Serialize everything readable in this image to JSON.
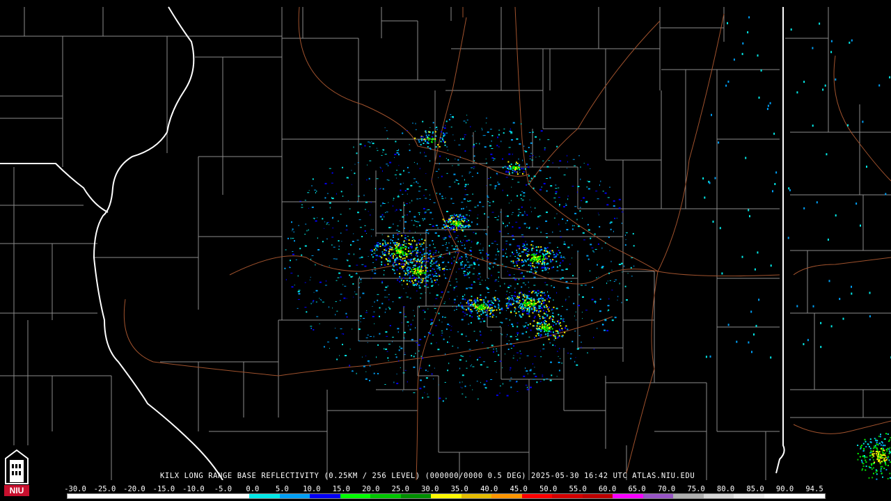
{
  "product": {
    "title": "KILX LONG RANGE BASE REFLECTIVITY (0.25KM / 256 LEVEL) (000000/0000 0.5 DEG) 2025-05-30 16:42 UTC  ATLAS.NIU.EDU"
  },
  "logo": {
    "text": "NIU",
    "icon": "niu-tower-logo-icon",
    "color": "#c8102e"
  },
  "colors": {
    "background": "#000000",
    "county_border": "#8c8c8c",
    "state_border": "#ffffff",
    "highway": "#a0522d"
  },
  "color_scale": {
    "labels": [
      "-30.0",
      "-25.0",
      "-20.0",
      "-15.0",
      "-10.0",
      "-5.0",
      "0.0",
      "5.0",
      "10.0",
      "15.0",
      "20.0",
      "25.0",
      "30.0",
      "35.0",
      "40.0",
      "45.0",
      "50.0",
      "55.0",
      "60.0",
      "65.0",
      "70.0",
      "75.0",
      "80.0",
      "85.0",
      "90.0",
      "94.5"
    ],
    "colors": [
      "#ffffff",
      "#ffffff",
      "#ffffff",
      "#ffffff",
      "#ffffff",
      "#ffffff",
      "#04e9e7",
      "#019ff4",
      "#0300f4",
      "#02fd02",
      "#01c501",
      "#008e00",
      "#fdf802",
      "#e5bc00",
      "#fd9500",
      "#fd0000",
      "#d40000",
      "#bc0000",
      "#f800fd",
      "#9854c6",
      "#b0b0b0",
      "#d8d8d8",
      "#eeeeee",
      "#ffffff",
      "#ffffff"
    ]
  }
}
